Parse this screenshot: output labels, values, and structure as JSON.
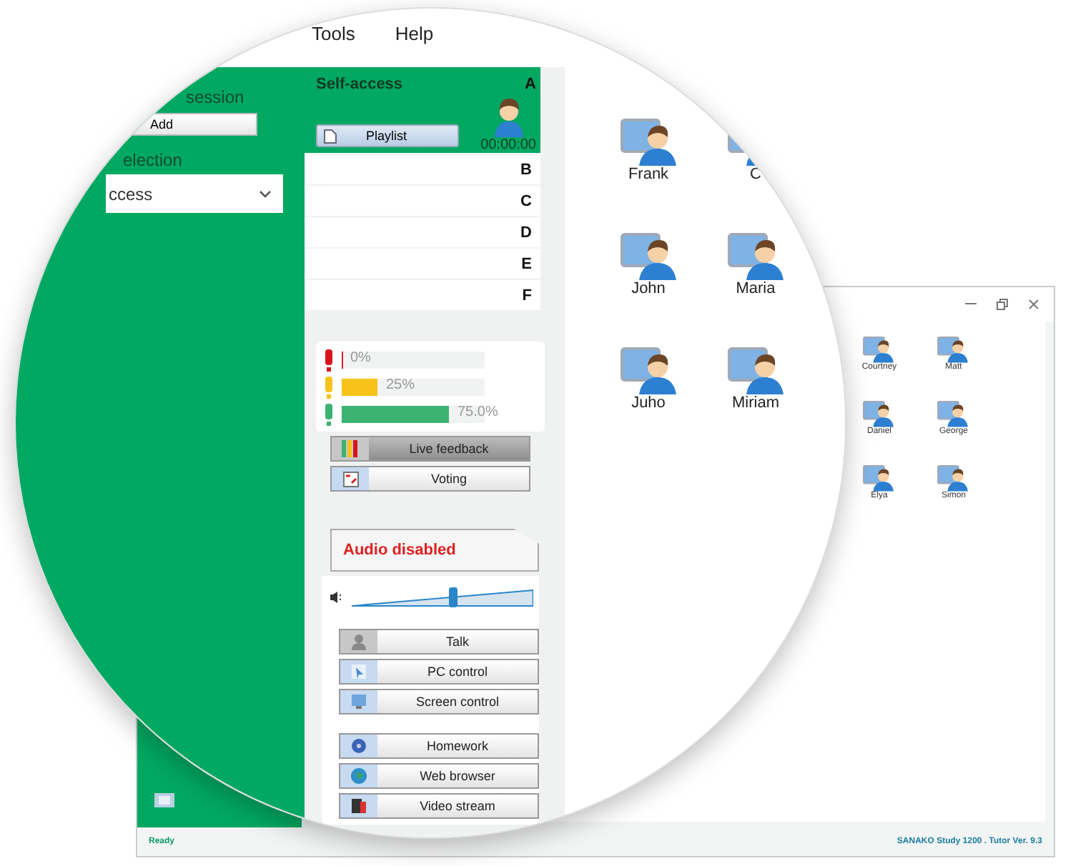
{
  "menu": [
    "Tools",
    "Help"
  ],
  "session": {
    "label": "session",
    "button": "Add"
  },
  "selection": {
    "label": "election",
    "value": "ccess"
  },
  "channels": {
    "title": "Self-access",
    "playlist": "Playlist",
    "timer": "00:00:00",
    "rows": [
      {
        "letter": "A",
        "selected": true
      },
      {
        "letter": "B",
        "selected": false
      },
      {
        "letter": "C",
        "selected": false
      },
      {
        "letter": "D",
        "selected": false
      },
      {
        "letter": "E",
        "selected": false
      },
      {
        "letter": "F",
        "selected": false
      }
    ]
  },
  "feedback": [
    {
      "color": "#d8141e",
      "level": 0,
      "reading": "0%"
    },
    {
      "color": "#f7c21a",
      "level": 0.25,
      "reading": "25%"
    },
    {
      "color": "#3cb371",
      "level": 0.75,
      "reading": "75.0%"
    }
  ],
  "feedback_buttons": [
    {
      "label": "Live feedback",
      "kind": "bars",
      "selected": true
    },
    {
      "label": "Voting",
      "kind": "ballot",
      "selected": false
    }
  ],
  "audio_status": "Audio disabled",
  "volume": {
    "level": 0.56
  },
  "control_groups": [
    [
      {
        "label": "Talk",
        "kind": "headset",
        "disabled": true
      },
      {
        "label": "PC control",
        "kind": "cursor",
        "disabled": false
      },
      {
        "label": "Screen control",
        "kind": "monitor",
        "disabled": false
      }
    ],
    [
      {
        "label": "Homework",
        "kind": "disk",
        "disabled": false
      },
      {
        "label": "Web browser",
        "kind": "globe",
        "disabled": false
      },
      {
        "label": "Video stream",
        "kind": "film",
        "disabled": false
      }
    ]
  ],
  "students": [
    "Frank",
    "C",
    "John",
    "Maria",
    "Juho",
    "Miriam"
  ],
  "window_students": [
    "Courtney",
    "Matt",
    "Daniel",
    "George",
    "Elya",
    "Simon"
  ],
  "status_bar": {
    "left": "Ready",
    "right": "SANAKO Study 1200 . Tutor Ver. 9.3"
  }
}
